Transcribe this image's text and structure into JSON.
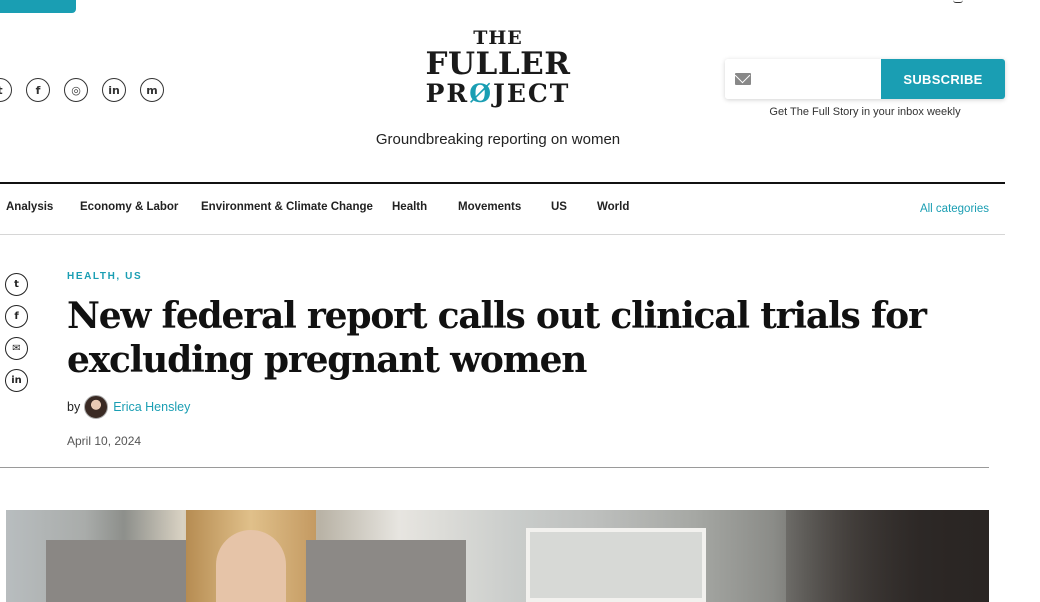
{
  "header": {
    "logo": {
      "line1": "THE",
      "line2": "FULLER",
      "line3_pre": "PR",
      "line3_o": "Ø",
      "line3_post": "JECT"
    },
    "tagline": "Groundbreaking reporting on women",
    "social_icons": [
      {
        "name": "twitter-icon",
        "glyph": "t"
      },
      {
        "name": "facebook-icon",
        "glyph": "f"
      },
      {
        "name": "instagram-icon",
        "glyph": "◎"
      },
      {
        "name": "linkedin-icon",
        "glyph": "in"
      },
      {
        "name": "mastodon-icon",
        "glyph": "m"
      }
    ]
  },
  "subscribe": {
    "placeholder": "",
    "button_label": "SUBSCRIBE",
    "note": "Get The Full Story in your inbox weekly",
    "accent_color": "#1a9eb3"
  },
  "nav": {
    "items": [
      "Analysis",
      "Economy & Labor",
      "Environment & Climate Change",
      "Health",
      "Movements",
      "US",
      "World"
    ],
    "all_label": "All categories"
  },
  "share_rail": [
    {
      "name": "share-twitter-icon",
      "glyph": "t"
    },
    {
      "name": "share-facebook-icon",
      "glyph": "f"
    },
    {
      "name": "share-email-icon",
      "glyph": "✉"
    },
    {
      "name": "share-linkedin-icon",
      "glyph": "in"
    }
  ],
  "article": {
    "kicker": "HEALTH, US",
    "headline": "New federal report calls out clinical trials for excluding pregnant women",
    "by_label": "by",
    "author": "Erica Hensley",
    "date": "April 10, 2024"
  }
}
